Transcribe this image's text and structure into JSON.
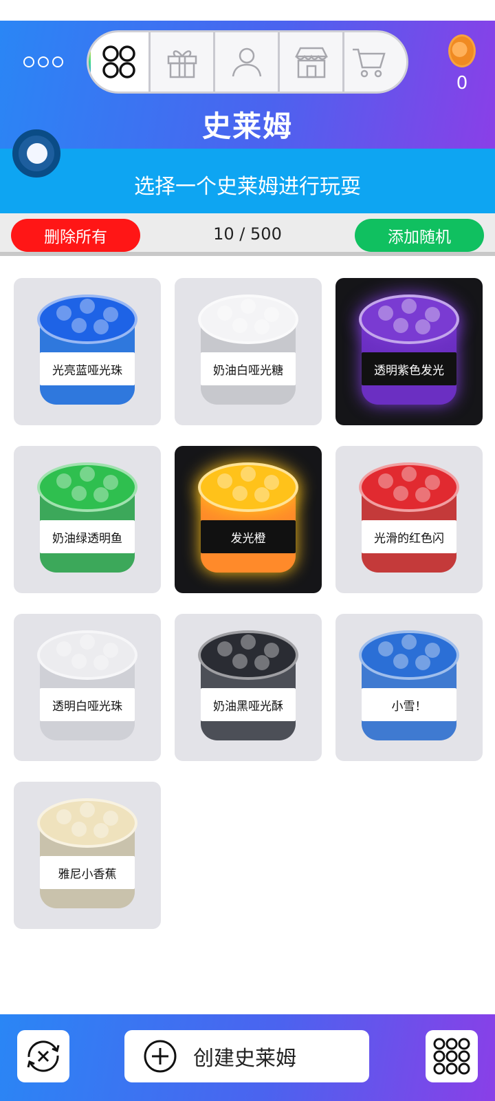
{
  "header": {
    "title": "史莱姆",
    "coin_count": "0",
    "tabs": [
      {
        "icon": "slime-grid-icon",
        "active": true
      },
      {
        "icon": "gift-icon",
        "active": false
      },
      {
        "icon": "person-icon",
        "active": false
      },
      {
        "icon": "shop-icon",
        "active": false
      },
      {
        "icon": "cart-icon",
        "active": false
      }
    ]
  },
  "subtitle": "选择一个史莱姆进行玩耍",
  "actions": {
    "delete_all_label": "删除所有",
    "count": "10 / 500",
    "add_random_label": "添加随机"
  },
  "slimes": [
    {
      "label": "光亮蓝哑光珠",
      "lid": "#1e63e6",
      "body": "#2f78dd",
      "dark": false
    },
    {
      "label": "奶油白哑光糖",
      "lid": "#f4f4f6",
      "body": "#c7c8cd",
      "dark": false
    },
    {
      "label": "透明紫色发光",
      "lid": "#7a3bd2",
      "body": "#6b2fc2",
      "dark": true
    },
    {
      "label": "奶油绿透明鱼",
      "lid": "#2fbf4f",
      "body": "#3ca85a",
      "dark": false
    },
    {
      "label": "发光橙",
      "lid": "#ffc21a",
      "body": "#ff8a2a",
      "dark": true
    },
    {
      "label": "光滑的红色闪",
      "lid": "#e12a30",
      "body": "#c43a3a",
      "dark": false
    },
    {
      "label": "透明白哑光珠",
      "lid": "#ececef",
      "body": "#cfd0d6",
      "dark": false
    },
    {
      "label": "奶油黑哑光酥",
      "lid": "#2a2c33",
      "body": "#4c4f57",
      "dark": false
    },
    {
      "label": "小雪！",
      "lid": "#2b6fd6",
      "body": "#3f7ad1",
      "dark": false
    },
    {
      "label": "雅尼小香蕉",
      "lid": "#efe2bd",
      "body": "#c9c2ac",
      "dark": false
    }
  ],
  "bottom": {
    "create_label": "创建史莱姆"
  },
  "colors": {
    "accent_blue": "#0ea5f2",
    "delete_red": "#ff1616",
    "add_green": "#10c060"
  }
}
